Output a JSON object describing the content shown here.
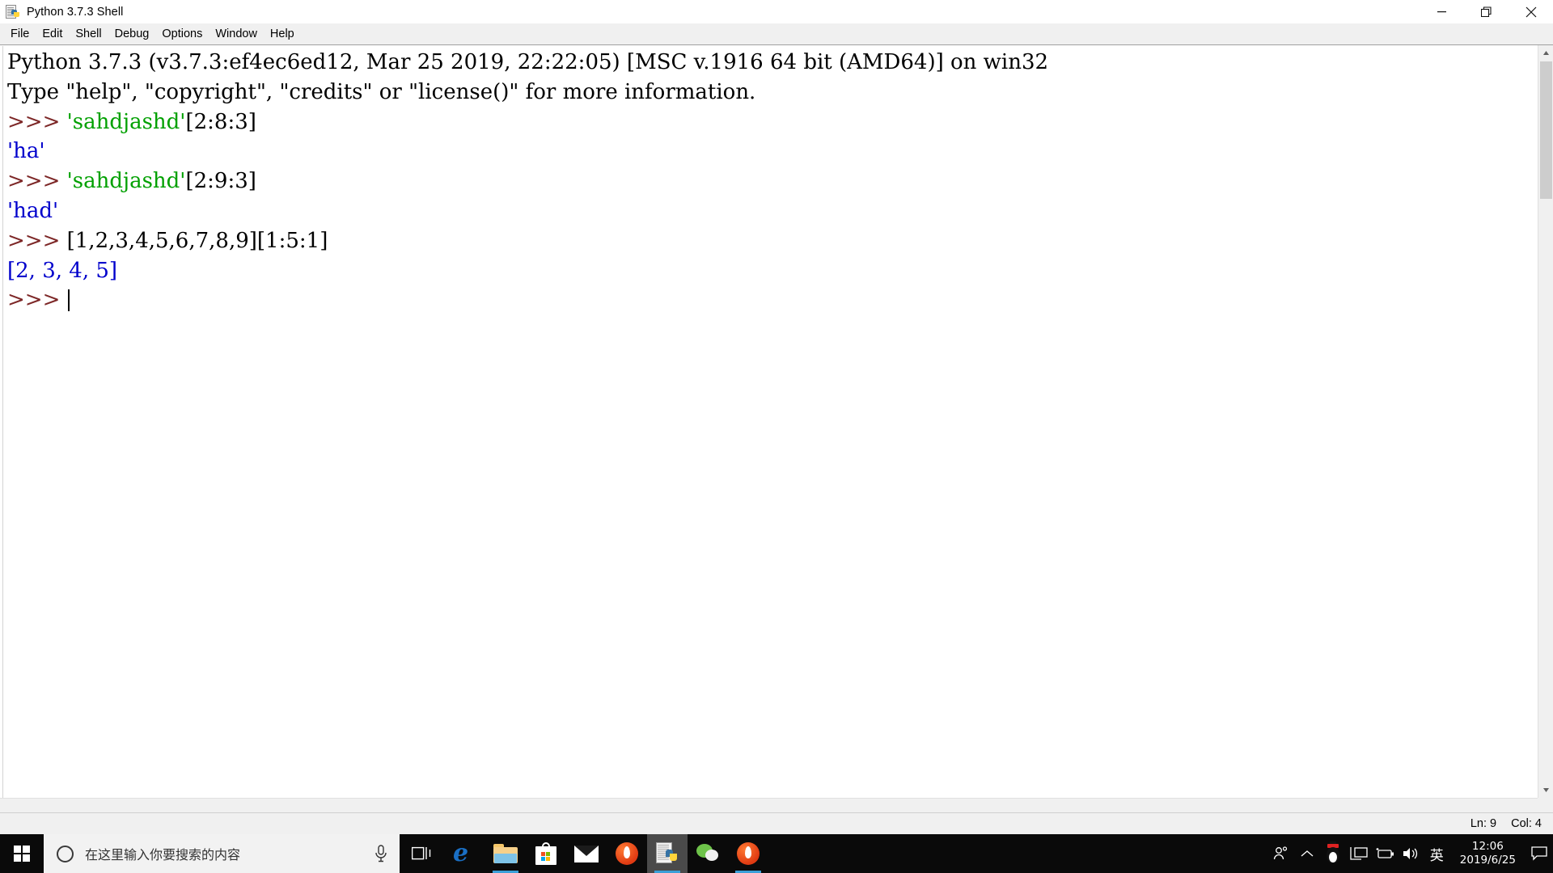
{
  "window": {
    "title": "Python 3.7.3 Shell",
    "icon": "python-idle-icon",
    "minimize_label": "Minimize",
    "restore_label": "Restore",
    "close_label": "Close"
  },
  "menubar": {
    "items": [
      {
        "label": "File"
      },
      {
        "label": "Edit"
      },
      {
        "label": "Shell"
      },
      {
        "label": "Debug"
      },
      {
        "label": "Options"
      },
      {
        "label": "Window"
      },
      {
        "label": "Help"
      }
    ]
  },
  "shell": {
    "lines": [
      {
        "id": "l1",
        "segments": [
          {
            "text": "Python 3.7.3 (v3.7.3:ef4ec6ed12, Mar 25 2019, 22:22:05) [MSC v.1916 64 bit (AMD64)] on win32",
            "kind": "plain"
          }
        ]
      },
      {
        "id": "l2",
        "segments": [
          {
            "text": "Type \"help\", \"copyright\", \"credits\" or \"license()\" for more information.",
            "kind": "plain"
          }
        ]
      },
      {
        "id": "l3",
        "segments": [
          {
            "text": ">>> ",
            "kind": "prompt"
          },
          {
            "text": "'sahdjashd'",
            "kind": "string"
          },
          {
            "text": "[2:8:3]",
            "kind": "plain"
          }
        ]
      },
      {
        "id": "l4",
        "segments": [
          {
            "text": "'ha'",
            "kind": "output"
          }
        ]
      },
      {
        "id": "l5",
        "segments": [
          {
            "text": ">>> ",
            "kind": "prompt"
          },
          {
            "text": "'sahdjashd'",
            "kind": "string"
          },
          {
            "text": "[2:9:3]",
            "kind": "plain"
          }
        ]
      },
      {
        "id": "l6",
        "segments": [
          {
            "text": "'had'",
            "kind": "output"
          }
        ]
      },
      {
        "id": "l7",
        "segments": [
          {
            "text": ">>> ",
            "kind": "prompt"
          },
          {
            "text": "[1,2,3,4,5,6,7,8,9][1:5:1]",
            "kind": "plain"
          }
        ]
      },
      {
        "id": "l8",
        "segments": [
          {
            "text": "[2, 3, 4, 5]",
            "kind": "output"
          }
        ]
      },
      {
        "id": "l9",
        "segments": [
          {
            "text": ">>> ",
            "kind": "prompt"
          }
        ],
        "caret": true
      }
    ],
    "colors": {
      "prompt": "#7d2727",
      "string": "#00a000",
      "output": "#0000cc",
      "plain": "#000000",
      "background": "#ffffff"
    }
  },
  "statusbar": {
    "line_label": "Ln: 9",
    "col_label": "Col: 4"
  },
  "taskbar": {
    "start_label": "Start",
    "search": {
      "placeholder": "在这里输入你要搜索的内容",
      "value": "",
      "mic_label": "Cortana microphone"
    },
    "task_view_label": "Task View",
    "apps": [
      {
        "name": "microsoft-edge",
        "label": "Microsoft Edge",
        "icon": "edge-icon",
        "running": false,
        "active": false
      },
      {
        "name": "file-explorer",
        "label": "File Explorer",
        "icon": "folder-icon",
        "running": true,
        "active": false
      },
      {
        "name": "microsoft-store",
        "label": "Microsoft Store",
        "icon": "store-icon",
        "running": false,
        "active": false
      },
      {
        "name": "mail",
        "label": "Mail",
        "icon": "mail-icon",
        "running": false,
        "active": false
      },
      {
        "name": "burning-app",
        "label": "Burn",
        "icon": "flame-icon",
        "running": false,
        "active": false
      },
      {
        "name": "python-idle",
        "label": "Python 3.7.3 Shell",
        "icon": "python-idle-icon",
        "running": true,
        "active": true
      },
      {
        "name": "wechat",
        "label": "WeChat",
        "icon": "wechat-icon",
        "running": false,
        "active": false
      },
      {
        "name": "burning-app-2",
        "label": "Burn",
        "icon": "flame-icon",
        "running": true,
        "active": false
      }
    ],
    "tray": [
      {
        "name": "people",
        "label": "People",
        "icon": "people-icon"
      },
      {
        "name": "show-hidden",
        "label": "Show hidden icons",
        "icon": "chevron-up-icon"
      },
      {
        "name": "qq",
        "label": "QQ",
        "icon": "penguin-icon"
      },
      {
        "name": "network",
        "label": "Network",
        "icon": "monitor-icon"
      },
      {
        "name": "battery",
        "label": "Battery",
        "icon": "battery-icon"
      },
      {
        "name": "volume",
        "label": "Volume",
        "icon": "speaker-icon"
      }
    ],
    "ime": {
      "label": "英"
    },
    "clock": {
      "time": "12:06",
      "date": "2019/6/25"
    },
    "notifications_label": "Notifications"
  }
}
